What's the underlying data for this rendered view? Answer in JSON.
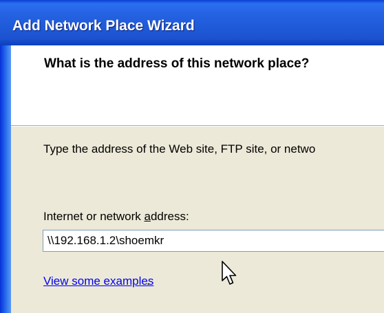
{
  "window": {
    "title": "Add Network Place Wizard"
  },
  "header": {
    "question": "What is the address of this network place?"
  },
  "body": {
    "description": "Type the address of the Web site, FTP site, or netwo",
    "address_label_before": "Internet or network ",
    "address_label_accel": "a",
    "address_label_after": "ddress:",
    "address_value": "\\\\192.168.1.2\\shoemkr",
    "examples_link": "View some examples",
    "examples_period": "."
  },
  "cursor": {
    "icon": "arrow-cursor-icon"
  }
}
